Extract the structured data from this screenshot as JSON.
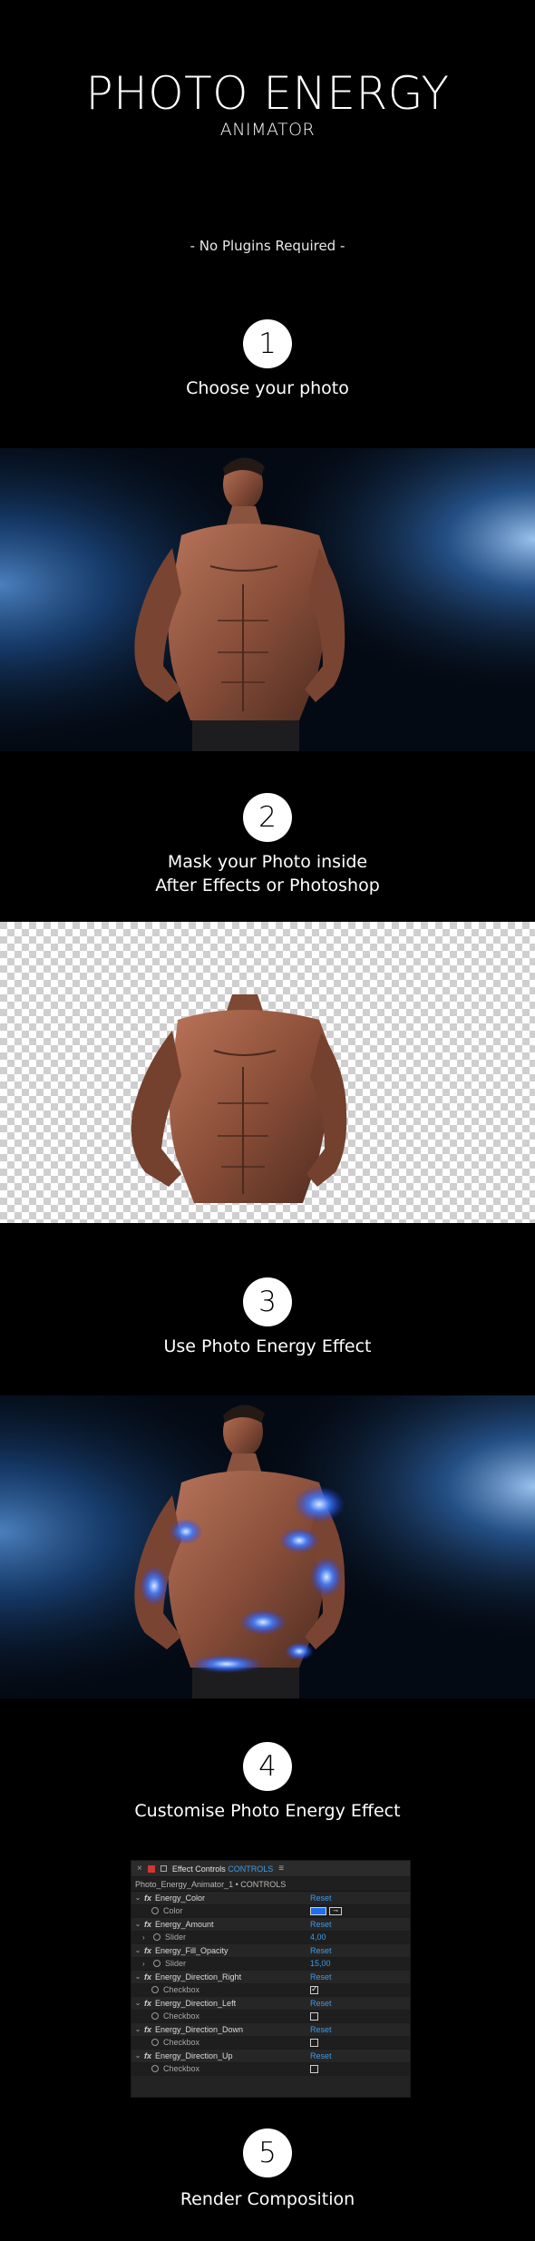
{
  "header": {
    "title": "PHOTO ENERGY",
    "subtitle": "ANIMATOR",
    "tagline": "- No Plugins Required -"
  },
  "steps": [
    {
      "number": "1",
      "text": "Choose your photo"
    },
    {
      "number": "2",
      "text_line1": "Mask your Photo inside",
      "text_line2": "After Effects or  Photoshop"
    },
    {
      "number": "3",
      "text": "Use Photo Energy Effect"
    },
    {
      "number": "4",
      "text": "Customise Photo Energy Effect"
    },
    {
      "number": "5",
      "text": "Render Composition"
    }
  ],
  "panel": {
    "close": "×",
    "title": "Effect Controls",
    "tab": "CONTROLS",
    "menu": "≡",
    "layer": "Photo_Energy_Animator_1 • CONTROLS",
    "reset_label": "Reset",
    "rows": [
      {
        "name": "Energy_Color",
        "param": "Color"
      },
      {
        "name": "Energy_Amount",
        "param": "Slider",
        "value": "4,00"
      },
      {
        "name": "Energy_Fill_Opacity",
        "param": "Slider",
        "value": "15,00"
      },
      {
        "name": "Energy_Direction_Right",
        "param": "Checkbox",
        "checked": true
      },
      {
        "name": "Energy_Direction_Left",
        "param": "Checkbox",
        "checked": false
      },
      {
        "name": "Energy_Direction_Down",
        "param": "Checkbox",
        "checked": false
      },
      {
        "name": "Energy_Direction_Up",
        "param": "Checkbox",
        "checked": false
      }
    ],
    "color_swatch": "#1c6ff0"
  },
  "colors": {
    "background": "#000000",
    "accent": "#3f9ae8",
    "smoke": "#1f5fa8",
    "energy_glow": "#3f7dff"
  }
}
